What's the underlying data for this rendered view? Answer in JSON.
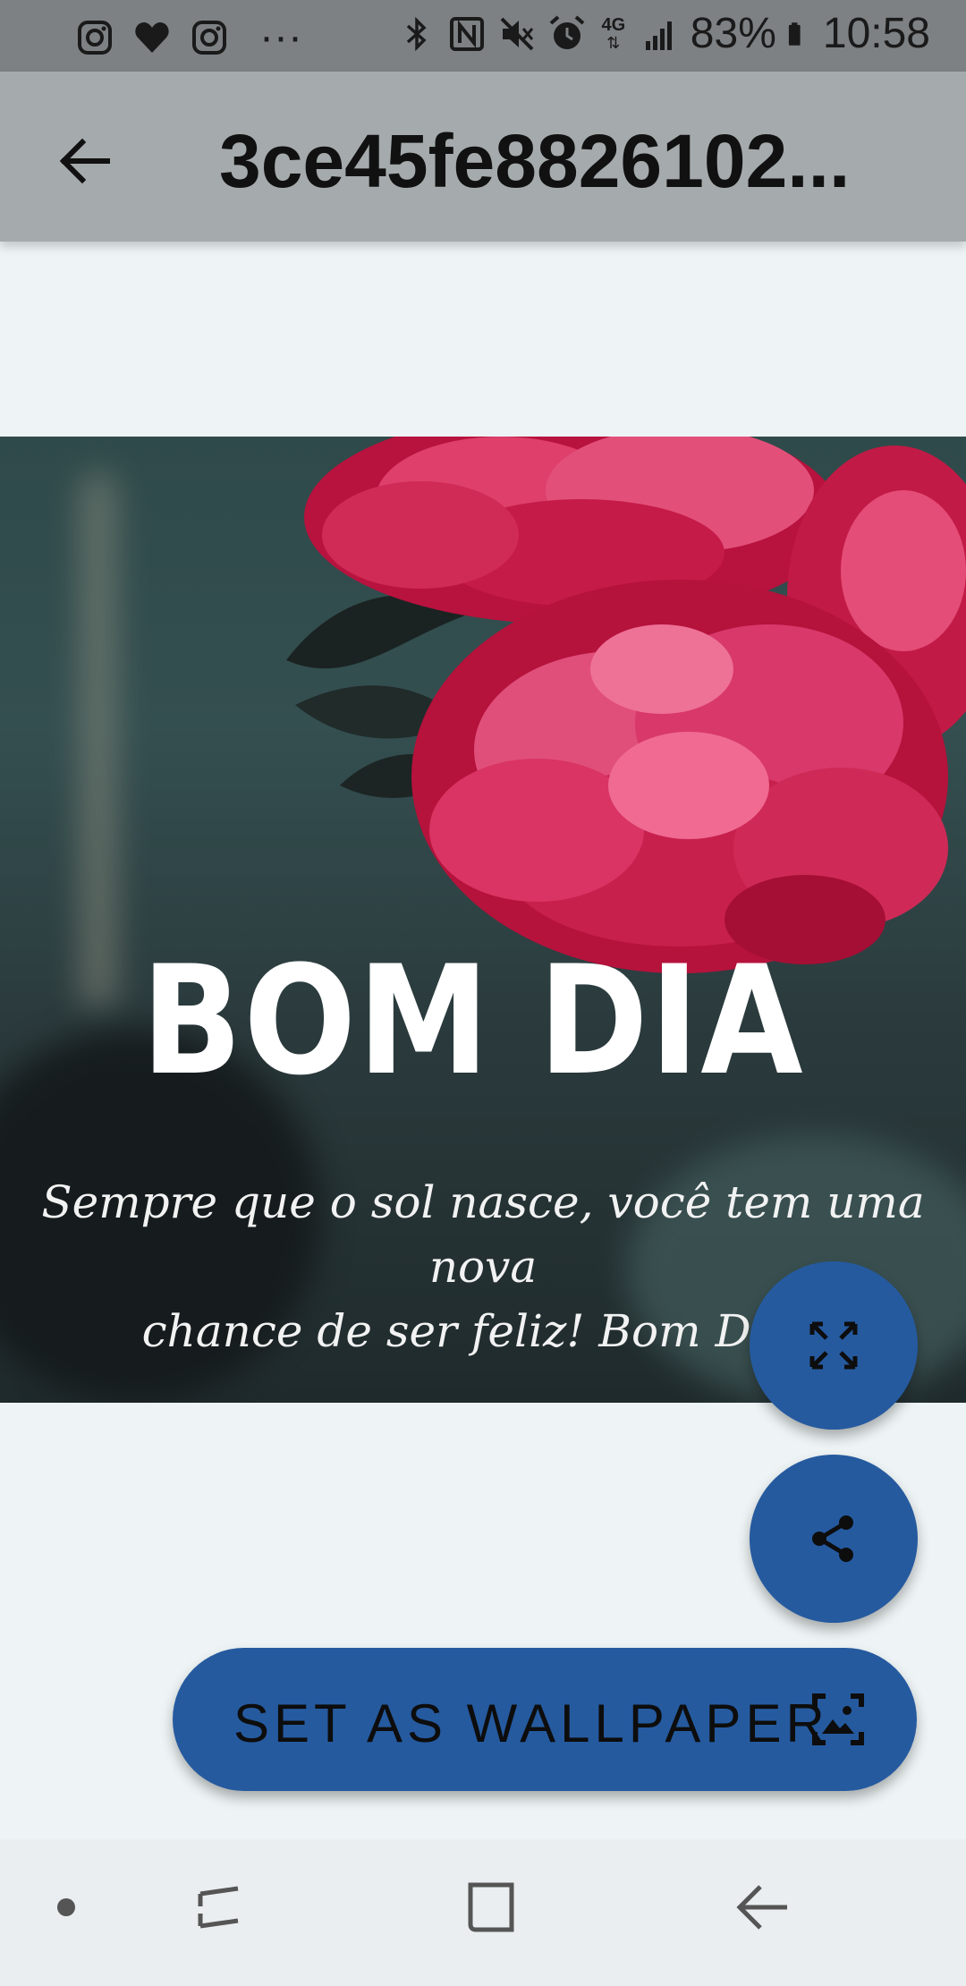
{
  "status_bar": {
    "left_icons": [
      "instagram-icon",
      "heart-icon",
      "instagram-icon",
      "more-dots-icon"
    ],
    "more_text": "···",
    "right_icons": [
      "bluetooth-icon",
      "nfc-icon",
      "mute-icon",
      "alarm-icon",
      "network-4g-icon",
      "signal-icon",
      "battery-icon"
    ],
    "network_label": "4G",
    "battery": "83%",
    "time": "10:58"
  },
  "app_bar": {
    "title": "3ce45fe8826102..."
  },
  "wallpaper": {
    "headline": "BOM DIA",
    "quote_line1": "Sempre que o sol nasce, você tem uma nova",
    "quote_line2": "chance de ser feliz! Bom Dia !"
  },
  "actions": {
    "set_wallpaper_label": "SET AS WALLPAPER"
  },
  "colors": {
    "accent": "#255a9f",
    "app_bar": "#a5aaac",
    "status_bar": "#7d8184",
    "background": "#eef4f5",
    "nav_bar": "#eaeef0"
  }
}
